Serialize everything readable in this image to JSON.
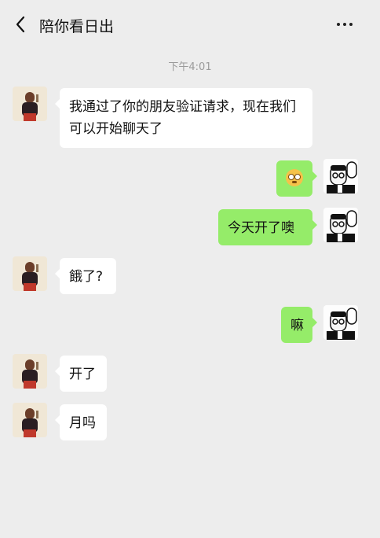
{
  "header": {
    "title": "陪你看日出",
    "back_icon": "back-chevron-icon",
    "more_icon": "more-dots-icon"
  },
  "timestamp": "下午4:01",
  "messages": [
    {
      "side": "in",
      "text": "我通过了你的朋友验证请求，现在我们可以开始聊天了"
    },
    {
      "side": "out",
      "type": "emoji",
      "emoji_icon": "surprised-face-emoji-icon"
    },
    {
      "side": "out",
      "text": "今天开了噢"
    },
    {
      "side": "in",
      "text": "餓了?"
    },
    {
      "side": "out",
      "text": "嘛"
    },
    {
      "side": "in",
      "text": "开了"
    },
    {
      "side": "in",
      "text": "月吗"
    }
  ],
  "colors": {
    "background": "#ededed",
    "outgoing_bubble": "#95ec69",
    "incoming_bubble": "#ffffff"
  }
}
